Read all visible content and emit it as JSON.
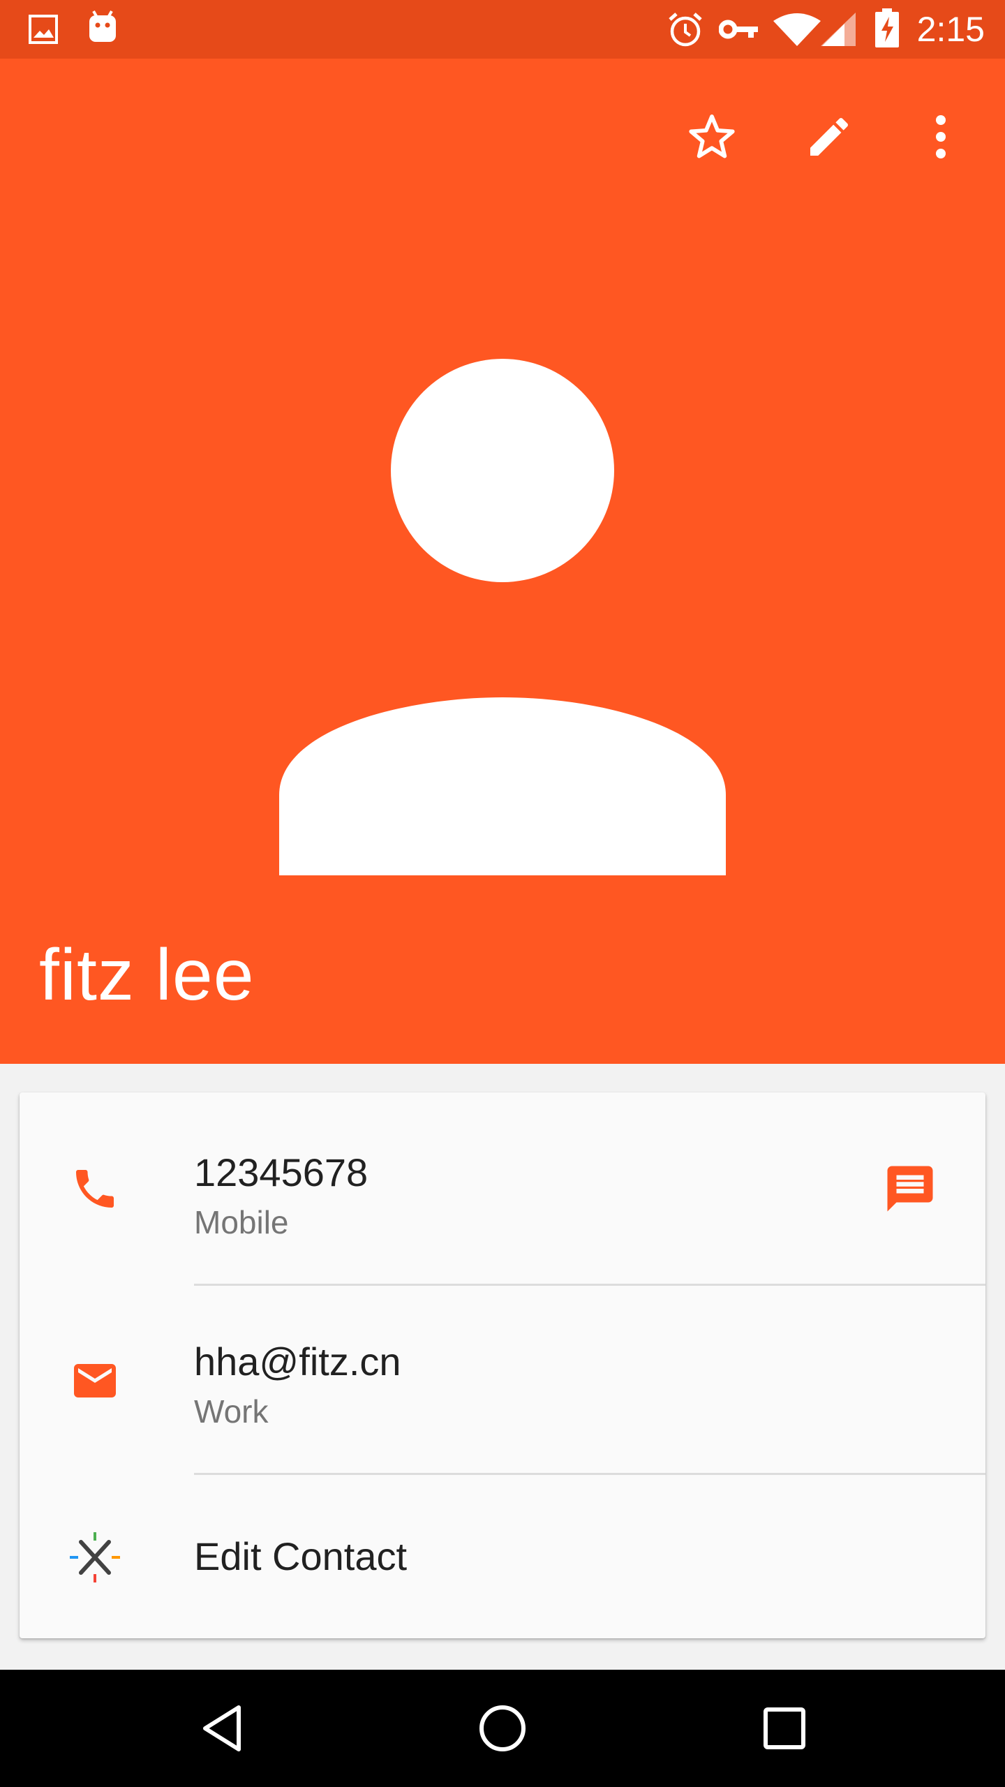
{
  "status_bar": {
    "time": "2:15",
    "icons": [
      "gallery-icon",
      "android-icon",
      "alarm-icon",
      "vpn-key-icon",
      "wifi-icon",
      "signal-icon",
      "battery-charging-icon"
    ]
  },
  "header": {
    "actions": [
      "star-icon",
      "edit-icon",
      "more-vert-icon"
    ],
    "contact_name": "fitz lee",
    "background_color": "#ff5722",
    "status_bar_color": "#e64a19"
  },
  "details": {
    "phone": {
      "number": "12345678",
      "type": "Mobile",
      "icon": "phone-icon",
      "action_icon": "message-icon"
    },
    "email": {
      "address": "hha@fitz.cn",
      "type": "Work",
      "icon": "email-icon"
    },
    "edit": {
      "label": "Edit Contact",
      "icon": "edit-contact-icon"
    }
  },
  "nav_bar": {
    "buttons": [
      "back-icon",
      "home-icon",
      "recents-icon"
    ]
  }
}
